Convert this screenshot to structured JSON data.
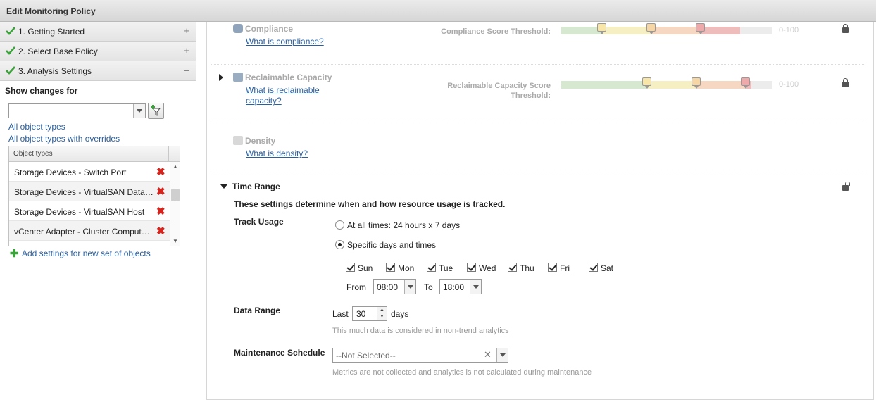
{
  "window": {
    "title": "Edit Monitoring Policy"
  },
  "steps": [
    {
      "label": "1. Getting Started",
      "toggle": "+"
    },
    {
      "label": "2. Select Base Policy",
      "toggle": "+"
    },
    {
      "label": "3. Analysis Settings",
      "toggle": "–"
    }
  ],
  "left": {
    "show_changes_label": "Show changes for",
    "combo_value": "",
    "all_object_types": "All object types",
    "all_object_types_overrides": "All object types with overrides",
    "grid_header": "Object types",
    "rows": [
      "Storage Devices - Switch Port",
      "Storage Devices - VirtualSAN Datastore",
      "Storage Devices - VirtualSAN Host",
      "vCenter Adapter - Cluster Compute Resource"
    ],
    "add_settings": "Add settings for new set of objects"
  },
  "compliance": {
    "title": "Compliance",
    "link": "What is compliance?",
    "threshold_label": "Compliance Score Threshold:",
    "range": "0-100"
  },
  "reclaimable": {
    "title": "Reclaimable Capacity",
    "link_line1": "What is reclaimable",
    "link_line2": "capacity?",
    "threshold_line1": "Reclaimable Capacity Score",
    "threshold_line2": "Threshold:",
    "range": "0-100"
  },
  "density": {
    "title": "Density",
    "link": "What is density?"
  },
  "time_range": {
    "title": "Time Range",
    "description": "These settings determine when and how resource usage is tracked.",
    "track_usage_label": "Track Usage",
    "option_all": "At all times: 24 hours x 7 days",
    "option_specific": "Specific days and times",
    "selected_option": "Specific days and times",
    "days": [
      {
        "label": "Sun",
        "checked": true
      },
      {
        "label": "Mon",
        "checked": true
      },
      {
        "label": "Tue",
        "checked": true
      },
      {
        "label": "Wed",
        "checked": true
      },
      {
        "label": "Thu",
        "checked": true
      },
      {
        "label": "Fri",
        "checked": true
      },
      {
        "label": "Sat",
        "checked": true
      }
    ],
    "from_label": "From",
    "from_value": "08:00",
    "to_label": "To",
    "to_value": "18:00",
    "data_range_label": "Data Range",
    "last_label": "Last",
    "last_value": "30",
    "days_label": "days",
    "data_range_note": "This much data is considered in non-trend analytics",
    "maintenance_label": "Maintenance Schedule",
    "maintenance_value": "--Not Selected--",
    "maintenance_note": "Metrics are not collected and analytics is not calculated during maintenance"
  },
  "colors": {
    "green": "#d6e8cf",
    "yellow": "#f6efc4",
    "orange": "#f6d8c2",
    "red": "#efbcbc",
    "link": "#2a5f9e",
    "check": "#3aa33a",
    "delete": "#d8231c"
  }
}
